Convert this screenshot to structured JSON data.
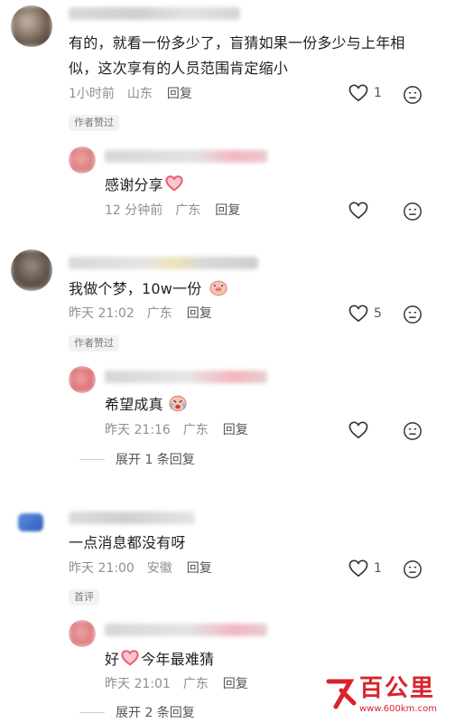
{
  "comments": [
    {
      "text": "有的，就看一份多少了，盲猜如果一份多少与上年相似，这次享有的人员范围肯定缩小",
      "time": "1小时前",
      "location": "山东",
      "reply": "回复",
      "likes": "1",
      "badge": "作者赞过",
      "reply_item": {
        "text": "感谢分享",
        "time": "12 分钟前",
        "location": "广东",
        "reply": "回复"
      }
    },
    {
      "text": "我做个梦，10w一份",
      "time": "昨天 21:02",
      "location": "广东",
      "reply": "回复",
      "likes": "5",
      "badge": "作者赞过",
      "reply_item": {
        "text": "希望成真",
        "time": "昨天 21:16",
        "location": "广东",
        "reply": "回复"
      },
      "expand": "展开 1 条回复"
    },
    {
      "text": "一点消息都没有呀",
      "time": "昨天 21:00",
      "location": "安徽",
      "reply": "回复",
      "likes": "1",
      "badge": "首评",
      "reply_item": {
        "text_before": "好",
        "text_after": "今年最难猜",
        "time": "昨天 21:01",
        "location": "广东",
        "reply": "回复"
      },
      "expand": "展开 2 条回复"
    }
  ],
  "watermark": {
    "brand": "百公里",
    "url": "www.600km.com"
  },
  "colors": {
    "meta_gray": "#8f8f8f",
    "badge_bg": "#f2f2f2",
    "heart_pink": "#ee5b73",
    "brand_red": "#d9222a"
  }
}
